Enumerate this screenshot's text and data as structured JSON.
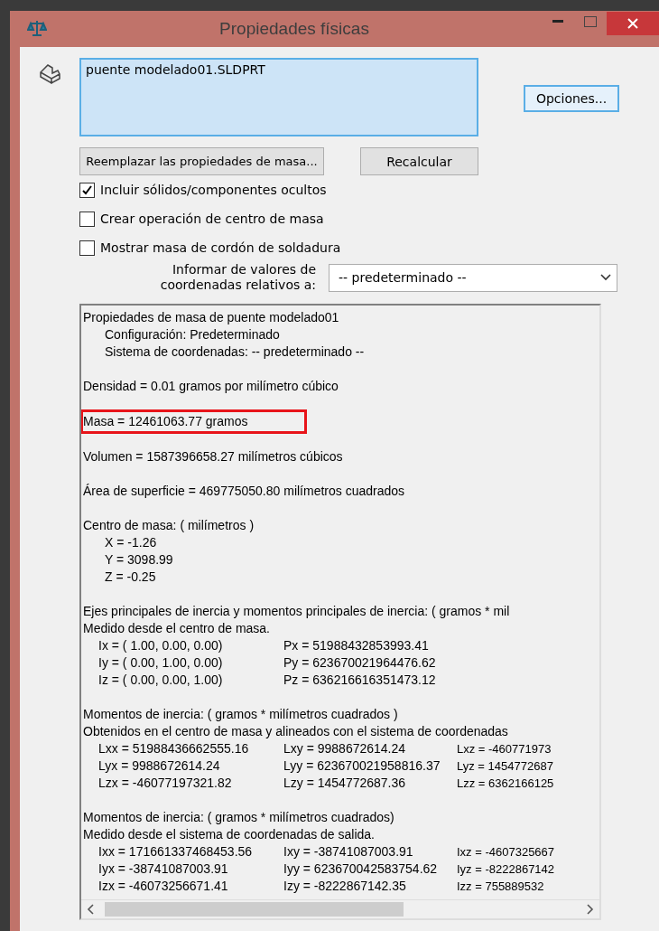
{
  "window": {
    "title": "Propiedades físicas"
  },
  "selection": {
    "value": "puente modelado01.SLDPRT"
  },
  "buttons": {
    "options": "Opciones...",
    "replace": "Reemplazar las propiedades de masa...",
    "recalc": "Recalcular"
  },
  "checkboxes": [
    {
      "label": "Incluir sólidos/componentes ocultos",
      "checked": true
    },
    {
      "label": "Crear operación de centro de masa",
      "checked": false
    },
    {
      "label": "Mostrar masa de cordón de soldadura",
      "checked": false
    }
  ],
  "coordinates": {
    "label": "Informar de valores de coordenadas relativos a:",
    "value": "-- predeterminado --"
  },
  "report": {
    "sections": [
      {
        "lines": [
          {
            "kind": "plain",
            "text": "Propiedades de masa de puente modelado01"
          },
          {
            "kind": "indent",
            "text": "Configuración:  Predeterminado"
          },
          {
            "kind": "indent",
            "text": "Sistema de coordenadas:  -- predeterminado --"
          }
        ]
      },
      {
        "lines": [
          {
            "kind": "plain",
            "text": "Densidad = 0.01 gramos por milímetro cúbico"
          }
        ]
      },
      {
        "lines": [
          {
            "kind": "plain",
            "text": "Masa = 12461063.77 gramos",
            "highlighted": true
          }
        ]
      },
      {
        "lines": [
          {
            "kind": "plain",
            "text": "Volumen = 1587396658.27 milímetros cúbicos"
          }
        ]
      },
      {
        "lines": [
          {
            "kind": "plain",
            "text": "Área de superficie = 469775050.80  milímetros cuadrados"
          }
        ]
      },
      {
        "lines": [
          {
            "kind": "plain",
            "text": "Centro de masa: ( milímetros )"
          },
          {
            "kind": "indent",
            "text": "X = -1.26"
          },
          {
            "kind": "indent",
            "text": "Y = 3098.99"
          },
          {
            "kind": "indent",
            "text": "Z = -0.25"
          }
        ]
      },
      {
        "lines": [
          {
            "kind": "plain",
            "text": "Ejes principales de inercia y momentos principales de inercia: ( gramos *  mil"
          },
          {
            "kind": "plain",
            "text": "Medido desde el centro de masa."
          },
          {
            "kind": "row",
            "cells": [
              "Ix = ( 1.00,  0.00,  0.00)",
              "Px = 51988432853993.41"
            ]
          },
          {
            "kind": "row",
            "cells": [
              "Iy = ( 0.00,  1.00,  0.00)",
              "Py = 623670021964476.62"
            ]
          },
          {
            "kind": "row",
            "cells": [
              "Iz = ( 0.00,  0.00,  1.00)",
              "Pz = 636216616351473.12"
            ]
          }
        ]
      },
      {
        "lines": [
          {
            "kind": "plain",
            "text": "Momentos de inercia: ( gramos *  milímetros cuadrados )"
          },
          {
            "kind": "plain",
            "text": "Obtenidos en el centro de masa y alineados con el sistema de coordenadas"
          },
          {
            "kind": "row",
            "cells": [
              "Lxx = 51988436662555.16",
              "Lxy = 9988672614.24",
              "Lxz = -460771973"
            ]
          },
          {
            "kind": "row",
            "cells": [
              "Lyx = 9988672614.24",
              "Lyy = 623670021958816.37",
              "Lyz = 1454772687"
            ]
          },
          {
            "kind": "row",
            "cells": [
              "Lzx = -46077197321.82",
              "Lzy = 1454772687.36",
              "Lzz = 6362166125"
            ]
          }
        ]
      },
      {
        "lines": [
          {
            "kind": "plain",
            "text": "Momentos de inercia: ( gramos *  milímetros cuadrados)"
          },
          {
            "kind": "plain",
            "text": "Medido desde el sistema de coordenadas de salida."
          },
          {
            "kind": "row",
            "cells": [
              "Ixx = 171661337468453.56",
              "Ixy = -38741087003.91",
              "Ixz = -4607325667"
            ]
          },
          {
            "kind": "row",
            "cells": [
              "Iyx = -38741087003.91",
              "Iyy = 623670042583754.62",
              "Iyz = -8222867142"
            ]
          },
          {
            "kind": "row",
            "cells": [
              "Izx = -46073256671.41",
              "Izy = -8222867142.35",
              "Izz = 755889532"
            ]
          }
        ]
      }
    ]
  }
}
